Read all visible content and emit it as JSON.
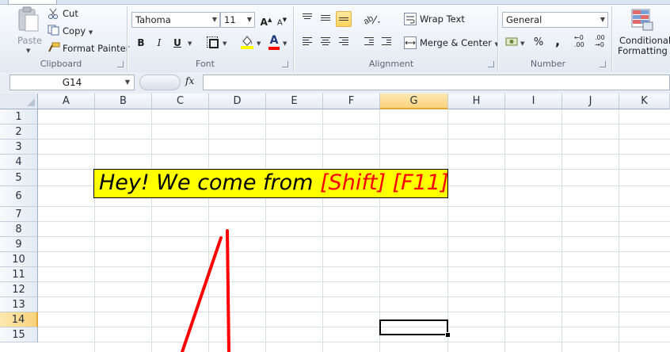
{
  "ribbon": {
    "clipboard": {
      "paste": "Paste",
      "cut": "Cut",
      "copy": "Copy",
      "format_painter": "Format Painter",
      "group": "Clipboard"
    },
    "font": {
      "name": "Tahoma",
      "size": "11",
      "bold": "B",
      "italic": "I",
      "underline": "U",
      "font_color_letter": "A",
      "group": "Font"
    },
    "alignment": {
      "wrap_text": "Wrap Text",
      "merge_center": "Merge & Center",
      "group": "Alignment"
    },
    "number": {
      "format": "General",
      "percent": "%",
      "comma": ",",
      "inc_decimal": ".00",
      "dec_decimal": ".00",
      "group": "Number"
    },
    "styles": {
      "conditional": "Conditional",
      "formatting": "Formatting"
    }
  },
  "formula_bar": {
    "name_box": "G14",
    "fx": "fx",
    "formula": ""
  },
  "sheet": {
    "columns": [
      "A",
      "B",
      "C",
      "D",
      "E",
      "F",
      "G",
      "H",
      "I",
      "J",
      "K"
    ],
    "selected_column": "G",
    "rows": [
      "1",
      "2",
      "3",
      "4",
      "5",
      "6",
      "7",
      "8",
      "9",
      "10",
      "11",
      "12",
      "13",
      "14",
      "15"
    ],
    "selected_row": "14",
    "textbox": {
      "text_black": "Hey! We come from ",
      "text_red": "[Shift] [F11]"
    }
  },
  "colors": {
    "textbox_fill": "#ffff00",
    "red": "#ff0000",
    "selection": "#f9d27a"
  }
}
